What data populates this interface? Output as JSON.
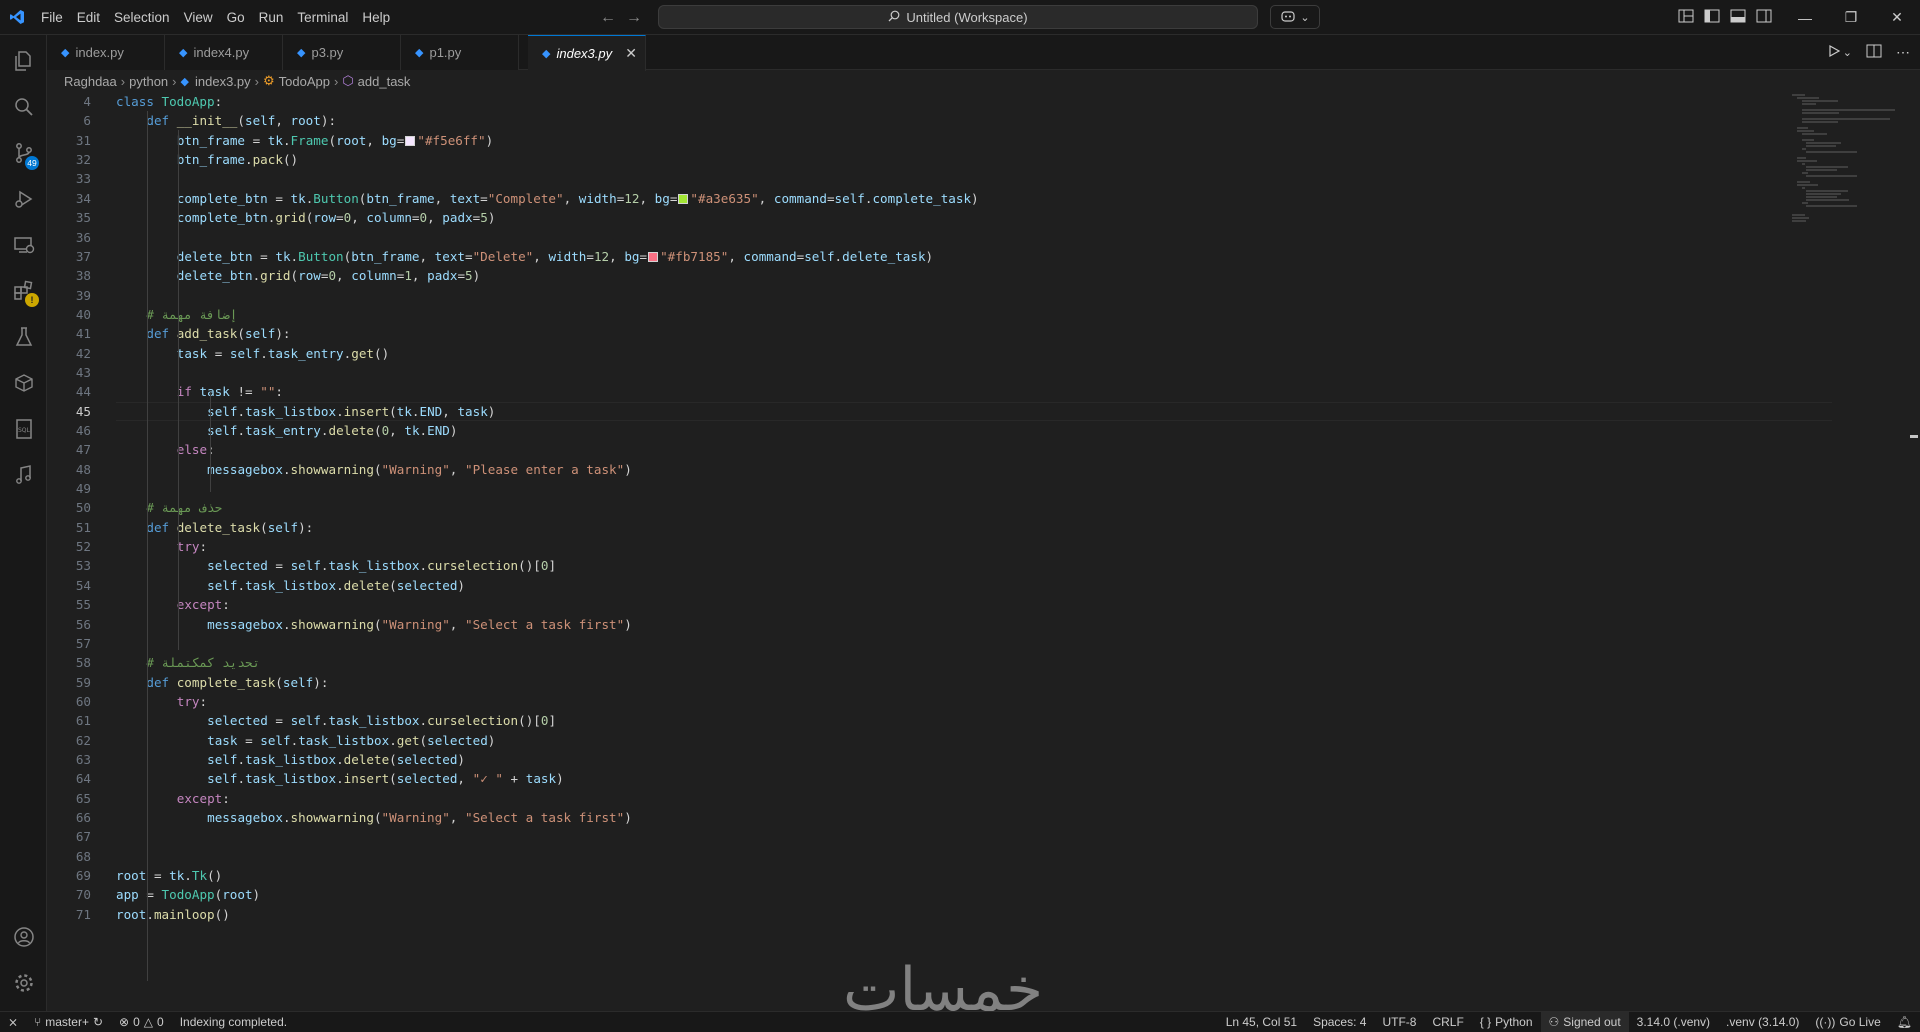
{
  "menu": [
    "File",
    "Edit",
    "Selection",
    "View",
    "Go",
    "Run",
    "Terminal",
    "Help"
  ],
  "command_center": "Untitled (Workspace)",
  "source_control_badge": "49",
  "tabs": [
    {
      "label": "index.py"
    },
    {
      "label": "index4.py"
    },
    {
      "label": "p3.py"
    },
    {
      "label": "p1.py"
    },
    {
      "label": "index3.py",
      "active": true
    }
  ],
  "breadcrumb": [
    "Raghdaa",
    "python",
    "index3.py",
    "TodoApp",
    "add_task"
  ],
  "code_lines": [
    {
      "n": "4",
      "t": "class TodoApp:"
    },
    {
      "n": "6",
      "t": "    def __init__(self, root):"
    },
    {
      "n": "31",
      "t": "        btn_frame = tk.Frame(root, bg=\"#f5e6ff\")"
    },
    {
      "n": "32",
      "t": "        btn_frame.pack()"
    },
    {
      "n": "33",
      "t": ""
    },
    {
      "n": "34",
      "t": "        complete_btn = tk.Button(btn_frame, text=\"Complete\", width=12, bg=\"#a3e635\", command=self.complete_task)"
    },
    {
      "n": "35",
      "t": "        complete_btn.grid(row=0, column=0, padx=5)"
    },
    {
      "n": "36",
      "t": ""
    },
    {
      "n": "37",
      "t": "        delete_btn = tk.Button(btn_frame, text=\"Delete\", width=12, bg=\"#fb7185\", command=self.delete_task)"
    },
    {
      "n": "38",
      "t": "        delete_btn.grid(row=0, column=1, padx=5)"
    },
    {
      "n": "39",
      "t": ""
    },
    {
      "n": "40",
      "t": "    # إضافة مهمة"
    },
    {
      "n": "41",
      "t": "    def add_task(self):"
    },
    {
      "n": "42",
      "t": "        task = self.task_entry.get()"
    },
    {
      "n": "43",
      "t": ""
    },
    {
      "n": "44",
      "t": "        if task != \"\":"
    },
    {
      "n": "45",
      "t": "            self.task_listbox.insert(tk.END, task)"
    },
    {
      "n": "46",
      "t": "            self.task_entry.delete(0, tk.END)"
    },
    {
      "n": "47",
      "t": "        else:"
    },
    {
      "n": "48",
      "t": "            messagebox.showwarning(\"Warning\", \"Please enter a task\")"
    },
    {
      "n": "49",
      "t": ""
    },
    {
      "n": "50",
      "t": "    # حذف مهمة"
    },
    {
      "n": "51",
      "t": "    def delete_task(self):"
    },
    {
      "n": "52",
      "t": "        try:"
    },
    {
      "n": "53",
      "t": "            selected = self.task_listbox.curselection()[0]"
    },
    {
      "n": "54",
      "t": "            self.task_listbox.delete(selected)"
    },
    {
      "n": "55",
      "t": "        except:"
    },
    {
      "n": "56",
      "t": "            messagebox.showwarning(\"Warning\", \"Select a task first\")"
    },
    {
      "n": "57",
      "t": ""
    },
    {
      "n": "58",
      "t": "    # تحديد كمكتملة"
    },
    {
      "n": "59",
      "t": "    def complete_task(self):"
    },
    {
      "n": "60",
      "t": "        try:"
    },
    {
      "n": "61",
      "t": "            selected = self.task_listbox.curselection()[0]"
    },
    {
      "n": "62",
      "t": "            task = self.task_listbox.get(selected)"
    },
    {
      "n": "63",
      "t": "            self.task_listbox.delete(selected)"
    },
    {
      "n": "64",
      "t": "            self.task_listbox.insert(selected, \"✓ \" + task)"
    },
    {
      "n": "65",
      "t": "        except:"
    },
    {
      "n": "66",
      "t": "            messagebox.showwarning(\"Warning\", \"Select a task first\")"
    },
    {
      "n": "67",
      "t": ""
    },
    {
      "n": "68",
      "t": ""
    },
    {
      "n": "69",
      "t": "root = tk.Tk()"
    },
    {
      "n": "70",
      "t": "app = TodoApp(root)"
    },
    {
      "n": "71",
      "t": "root.mainloop()"
    }
  ],
  "watermark": "خمسات",
  "status": {
    "branch": "master+",
    "errors": "0",
    "warnings": "0",
    "message": "Indexing completed.",
    "position": "Ln 45, Col 51",
    "spaces": "Spaces: 4",
    "encoding": "UTF-8",
    "eol": "CRLF",
    "language": "Python",
    "account": "Signed out",
    "python_version": "3.14.0 (.venv)",
    "venv": ".venv (3.14.0)",
    "golive": "Go Live"
  },
  "colors": {
    "accent": "#0078d4",
    "swatch_frame": "#f5e6ff",
    "swatch_complete": "#a3e635",
    "swatch_delete": "#fb7185"
  }
}
